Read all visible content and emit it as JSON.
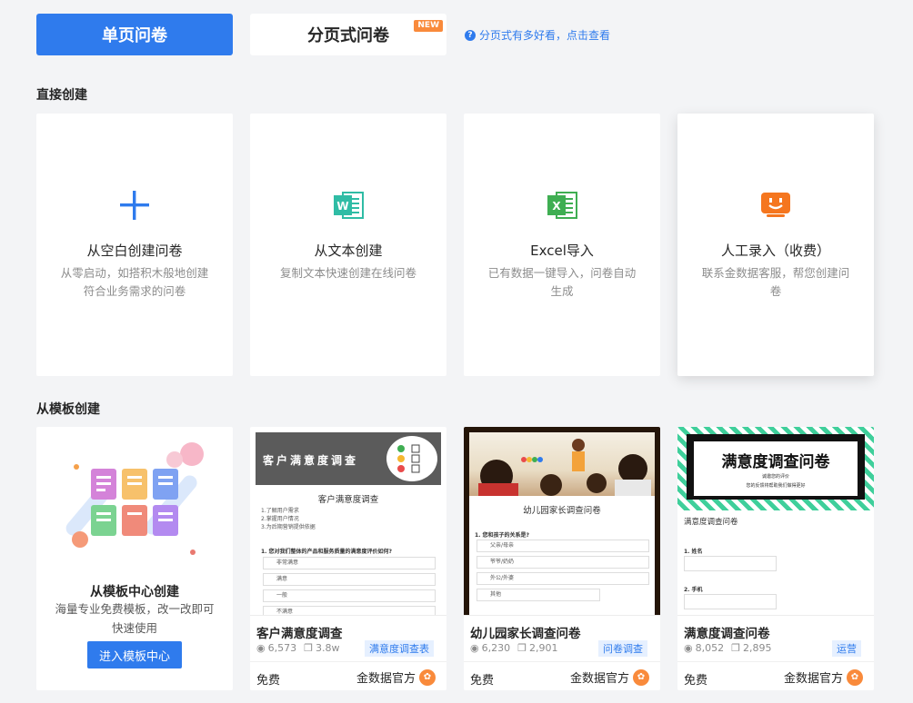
{
  "tabs": {
    "single": "单页问卷",
    "paged": "分页式问卷",
    "new_badge": "NEW",
    "help": "分页式有多好看，点击查看"
  },
  "sections": {
    "direct": "直接创建",
    "template": "从模板创建"
  },
  "create_cards": [
    {
      "title": "从空白创建问卷",
      "desc": "从零启动，如搭积木般地创建符合业务需求的问卷",
      "icon": "plus-icon",
      "color": "#2f7bed"
    },
    {
      "title": "从文本创建",
      "desc": "复制文本快速创建在线问卷",
      "icon": "word-doc-icon",
      "color": "#2fbca5"
    },
    {
      "title": "Excel导入",
      "desc": "已有数据一键导入，问卷自动生成",
      "icon": "excel-icon",
      "color": "#3fae52"
    },
    {
      "title": "人工录入（收费）",
      "desc": "联系金数据客服，帮您创建问卷",
      "icon": "monitor-smile-icon",
      "color": "#f5761f"
    }
  ],
  "template_center": {
    "title": "从模板中心创建",
    "desc": "海量专业免费模板，改一改即可快速使用",
    "button": "进入模板中心"
  },
  "templates": [
    {
      "name": "客户满意度调查",
      "views": "6,573",
      "uses": "3.8w",
      "tag": "满意度调查表",
      "price": "免费",
      "author": "金数据官方",
      "preview": {
        "banner": "客户满意度调查",
        "title": "客户满意度调查",
        "lines": [
          "1.了解用户需求",
          "2.掌握用户情况",
          "3.为后期营销提供依据"
        ],
        "question": "1. 您对我们整体的产品和服务质量的满意度评价如何?",
        "options": [
          "非常满意",
          "满意",
          "一般",
          "不满意"
        ]
      }
    },
    {
      "name": "幼儿园家长调查问卷",
      "views": "6,230",
      "uses": "2,901",
      "tag": "问卷调查",
      "price": "免费",
      "author": "金数据官方",
      "preview": {
        "title": "幼儿园家长调查问卷",
        "question": "1. 您和孩子的关系是?",
        "options": [
          "父亲/母亲",
          "爷爷/奶奶",
          "外公/外婆",
          "其他"
        ]
      }
    },
    {
      "name": "满意度调查问卷",
      "views": "8,052",
      "uses": "2,895",
      "tag": "运营",
      "price": "免费",
      "author": "金数据官方",
      "preview": {
        "banner": "满意度调查问卷",
        "small1": "诚邀您的评价",
        "small2": "您的反馈将帮助我们做得更好",
        "sub": "满意度调查问卷",
        "field1": "1. 姓名",
        "field2": "2. 手机"
      }
    }
  ]
}
